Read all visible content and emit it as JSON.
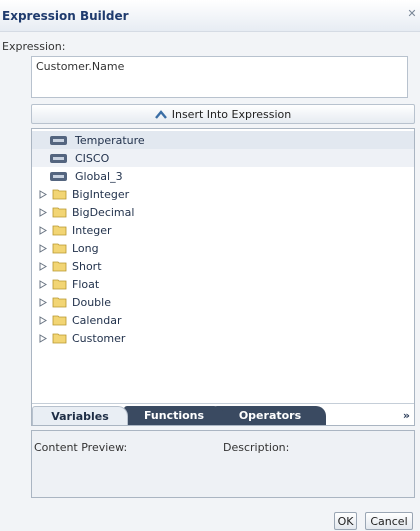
{
  "dialog": {
    "title": "Expression Builder",
    "close_icon": "close-icon"
  },
  "expression": {
    "label": "Expression:",
    "value": "Customer.Name"
  },
  "insert_button": {
    "label": "Insert Into Expression",
    "icon": "insert-arrow-icon"
  },
  "tree": {
    "variables": [
      "Temperature",
      "CISCO",
      "Global_3"
    ],
    "folders": [
      "BigInteger",
      "BigDecimal",
      "Integer",
      "Long",
      "Short",
      "Float",
      "Double",
      "Calendar",
      "Customer"
    ]
  },
  "tabs": {
    "variables": "Variables",
    "functions": "Functions",
    "operators": "Operators",
    "more": "»"
  },
  "preview": {
    "content_label": "Content Preview:",
    "description_label": "Description:"
  },
  "buttons": {
    "ok": "OK",
    "cancel": "Cancel"
  },
  "colors": {
    "title": "#1f3b6e",
    "tab_dark": "#3a4a61",
    "folder": "#e8c65a"
  }
}
